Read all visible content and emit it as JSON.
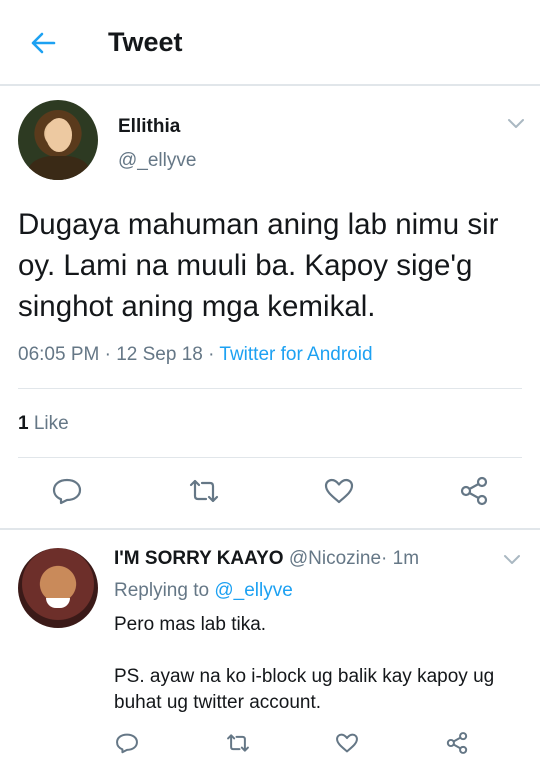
{
  "header": {
    "title": "Tweet"
  },
  "tweet": {
    "name": "Ellithia",
    "handle": "@_ellyve",
    "text": "Dugaya mahuman aning lab nimu sir oy. Lami na muuli ba. Kapoy sige'g singhot aning mga kemikal.",
    "time": "06:05 PM",
    "date": "12 Sep 18",
    "source": "Twitter for Android",
    "dot": "·",
    "like_count": "1",
    "like_label": "Like"
  },
  "reply": {
    "name": "I'M SORRY KAAYO",
    "handle": "@Nicozine",
    "dot": "·",
    "age": "1m",
    "replying_label": "Replying to",
    "replying_to": "@_ellyve",
    "line1": "Pero mas lab tika.",
    "line2": "PS. ayaw na ko i-block ug balik kay kapoy ug buhat ug twitter account."
  },
  "colors": {
    "accent": "#1da1f2",
    "text": "#14171a",
    "muted": "#657786",
    "divider": "#e1e6ea"
  },
  "icons": [
    "back-arrow-icon",
    "chevron-down-icon",
    "reply-icon",
    "retweet-icon",
    "like-icon",
    "share-icon"
  ]
}
